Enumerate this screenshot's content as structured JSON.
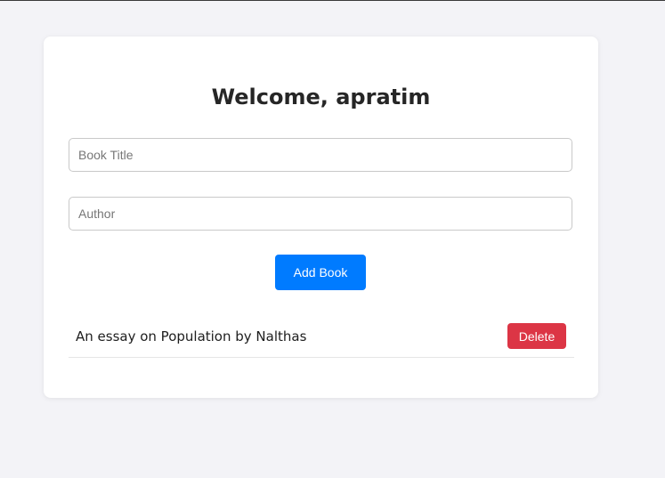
{
  "header": {
    "welcome": "Welcome, apratim"
  },
  "form": {
    "title_placeholder": "Book Title",
    "author_placeholder": "Author",
    "add_label": "Add Book"
  },
  "books": [
    {
      "text": "An essay on Population by Nalthas",
      "delete_label": "Delete"
    }
  ],
  "colors": {
    "primary": "#007bff",
    "danger": "#dc3545",
    "background": "#f3f3f7"
  }
}
